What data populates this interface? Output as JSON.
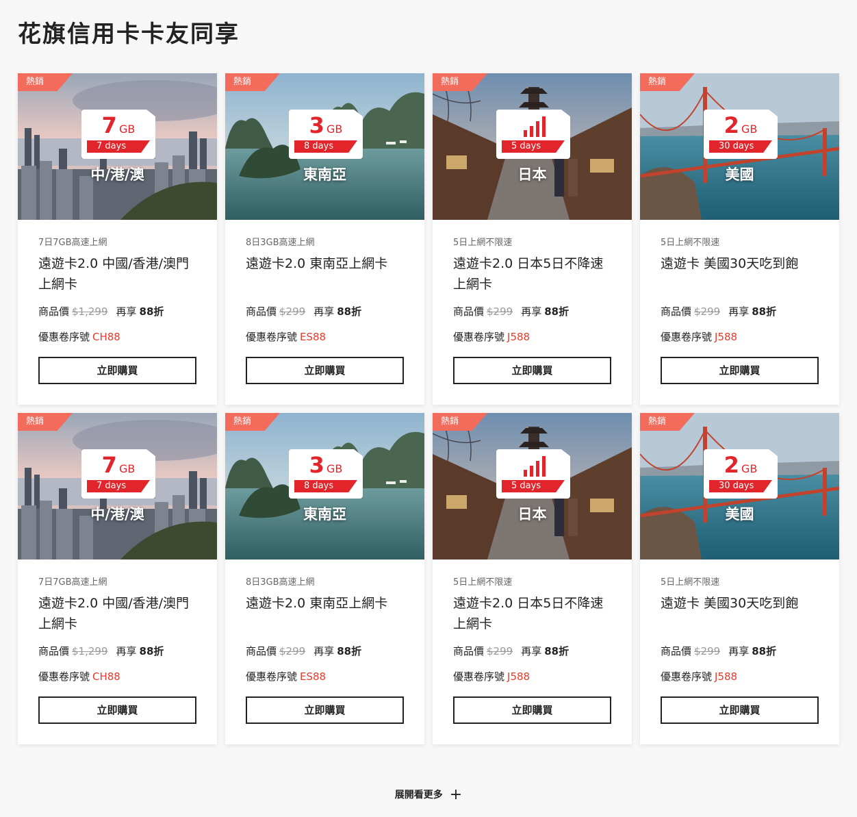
{
  "page": {
    "title": "花旗信用卡卡友同享"
  },
  "cards": [
    {
      "badge": "熱銷",
      "scene": "hongkong",
      "sim_amount": "7",
      "sim_unit": "GB",
      "sim_days": "7 days",
      "region": "中/港/澳",
      "subtitle": "7日7GB高速上網",
      "name": "遠遊卡2.0 中國/香港/澳門上網卡",
      "price_label": "商品價",
      "original_price": "$1,299",
      "discount_prefix": "再享",
      "discount": "88折",
      "coupon_label": "優惠卷序號",
      "coupon_code": "CH88",
      "button": "立即購買"
    },
    {
      "badge": "熱銷",
      "scene": "halong",
      "sim_amount": "3",
      "sim_unit": "GB",
      "sim_days": "8 days",
      "region": "東南亞",
      "subtitle": "8日3GB高速上網",
      "name": "遠遊卡2.0 東南亞上網卡",
      "price_label": "商品價",
      "original_price": "$299",
      "discount_prefix": "再享",
      "discount": "88折",
      "coupon_label": "優惠卷序號",
      "coupon_code": "ES88",
      "button": "立即購買"
    },
    {
      "badge": "熱銷",
      "scene": "kyoto",
      "sim_amount": "",
      "sim_unit": "",
      "sim_days": "5 days",
      "region": "日本",
      "subtitle": "5日上網不限速",
      "name": "遠遊卡2.0 日本5日不降速上網卡",
      "price_label": "商品價",
      "original_price": "$299",
      "discount_prefix": "再享",
      "discount": "88折",
      "coupon_label": "優惠卷序號",
      "coupon_code": "J588",
      "button": "立即購買"
    },
    {
      "badge": "熱銷",
      "scene": "goldengate",
      "sim_amount": "2",
      "sim_unit": "GB",
      "sim_days": "30 days",
      "region": "美國",
      "subtitle": "5日上網不限速",
      "name": "遠遊卡 美國30天吃到飽",
      "price_label": "商品價",
      "original_price": "$299",
      "discount_prefix": "再享",
      "discount": "88折",
      "coupon_label": "優惠卷序號",
      "coupon_code": "J588",
      "button": "立即購買"
    },
    {
      "badge": "熱銷",
      "scene": "hongkong",
      "sim_amount": "7",
      "sim_unit": "GB",
      "sim_days": "7 days",
      "region": "中/港/澳",
      "subtitle": "7日7GB高速上網",
      "name": "遠遊卡2.0 中國/香港/澳門上網卡",
      "price_label": "商品價",
      "original_price": "$1,299",
      "discount_prefix": "再享",
      "discount": "88折",
      "coupon_label": "優惠卷序號",
      "coupon_code": "CH88",
      "button": "立即購買"
    },
    {
      "badge": "熱銷",
      "scene": "halong",
      "sim_amount": "3",
      "sim_unit": "GB",
      "sim_days": "8 days",
      "region": "東南亞",
      "subtitle": "8日3GB高速上網",
      "name": "遠遊卡2.0 東南亞上網卡",
      "price_label": "商品價",
      "original_price": "$299",
      "discount_prefix": "再享",
      "discount": "88折",
      "coupon_label": "優惠卷序號",
      "coupon_code": "ES88",
      "button": "立即購買"
    },
    {
      "badge": "熱銷",
      "scene": "kyoto",
      "sim_amount": "",
      "sim_unit": "",
      "sim_days": "5 days",
      "region": "日本",
      "subtitle": "5日上網不限速",
      "name": "遠遊卡2.0 日本5日不降速上網卡",
      "price_label": "商品價",
      "original_price": "$299",
      "discount_prefix": "再享",
      "discount": "88折",
      "coupon_label": "優惠卷序號",
      "coupon_code": "J588",
      "button": "立即購買"
    },
    {
      "badge": "熱銷",
      "scene": "goldengate",
      "sim_amount": "2",
      "sim_unit": "GB",
      "sim_days": "30 days",
      "region": "美國",
      "subtitle": "5日上網不限速",
      "name": "遠遊卡 美國30天吃到飽",
      "price_label": "商品價",
      "original_price": "$299",
      "discount_prefix": "再享",
      "discount": "88折",
      "coupon_label": "優惠卷序號",
      "coupon_code": "J588",
      "button": "立即購買"
    }
  ],
  "colors": {
    "accent_red": "#e2242b",
    "badge_coral": "#f26b5b",
    "coupon_red": "#e8392b"
  },
  "load_more": {
    "label": "展開看更多",
    "icon": "plus-icon"
  }
}
